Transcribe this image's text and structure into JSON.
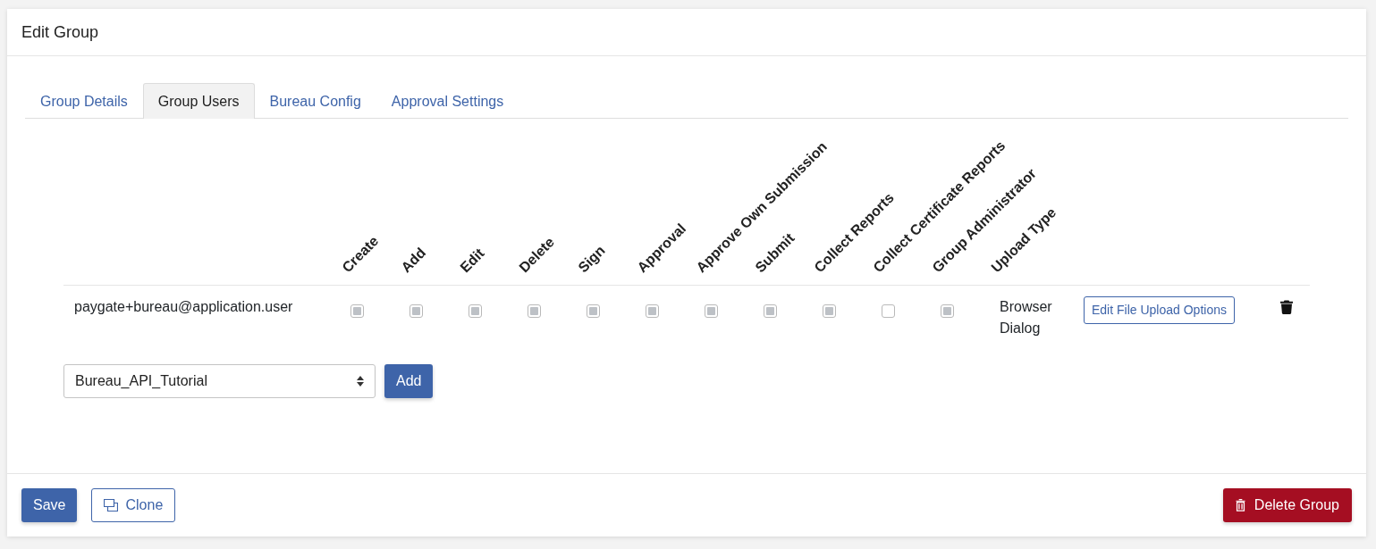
{
  "title": "Edit Group",
  "tabs": [
    {
      "label": "Group Details",
      "selected": false
    },
    {
      "label": "Group Users",
      "selected": true
    },
    {
      "label": "Bureau Config",
      "selected": false
    },
    {
      "label": "Approval Settings",
      "selected": false
    }
  ],
  "permissions_table": {
    "columns": [
      "Create",
      "Add",
      "Edit",
      "Delete",
      "Sign",
      "Approval",
      "Approve Own Submission",
      "Submit",
      "Collect Reports",
      "Collect Certificate Reports",
      "Group Administrator"
    ],
    "upload_type_column": "Upload Type",
    "rows": [
      {
        "user": "paygate+bureau@application.user",
        "permissions": [
          {
            "checked": true
          },
          {
            "checked": true
          },
          {
            "checked": true
          },
          {
            "checked": true
          },
          {
            "checked": true
          },
          {
            "checked": true
          },
          {
            "checked": true
          },
          {
            "checked": true
          },
          {
            "checked": true
          },
          {
            "checked": false
          },
          {
            "checked": true
          }
        ],
        "upload_type": "Browser Dialog",
        "upload_button": "Edit File Upload Options"
      }
    ]
  },
  "add_user": {
    "value": "Bureau_API_Tutorial",
    "button": "Add"
  },
  "footer": {
    "save": "Save",
    "clone": "Clone",
    "delete": "Delete Group"
  }
}
